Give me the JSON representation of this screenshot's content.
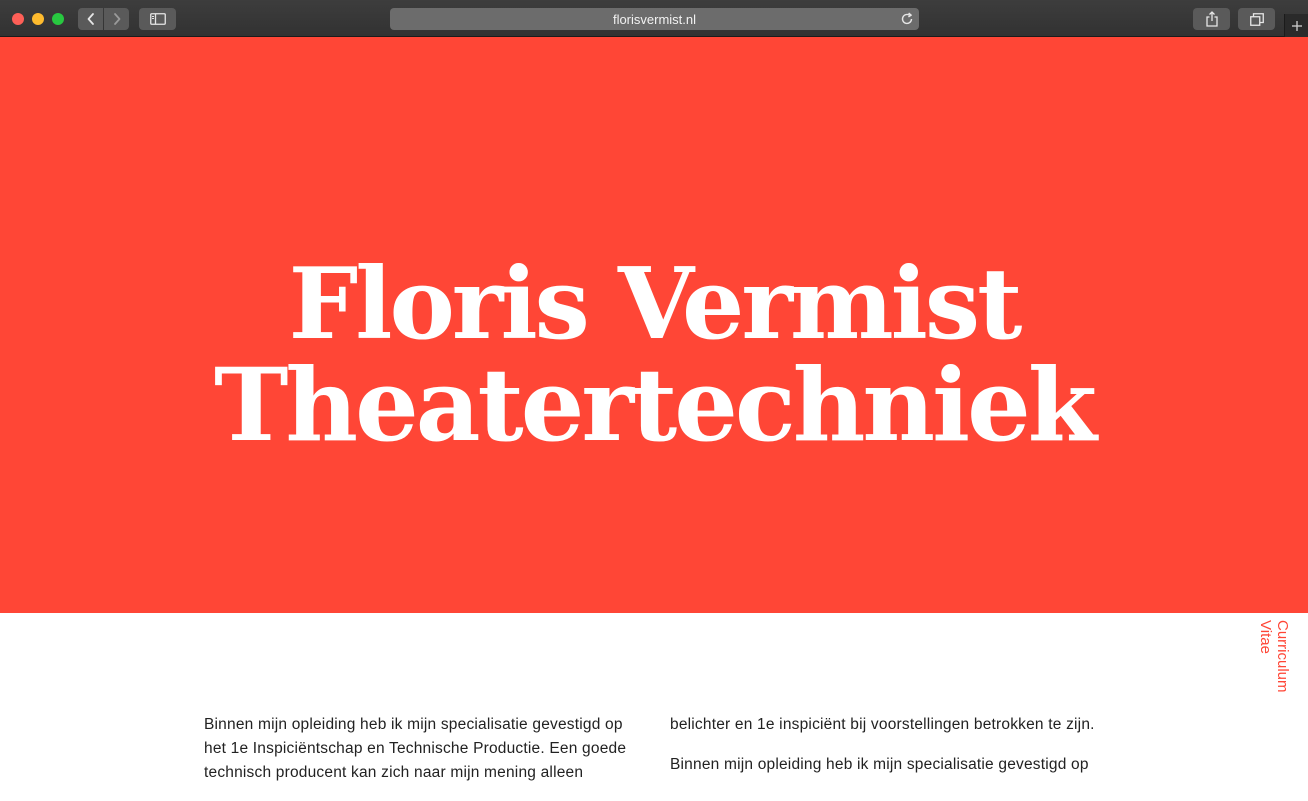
{
  "browser": {
    "url": "florisvermist.nl",
    "icons": [
      "chevron-left-icon",
      "chevron-right-icon",
      "sidebar-icon",
      "reload-icon",
      "share-icon",
      "tabs-icon",
      "plus-icon"
    ]
  },
  "hero": {
    "title_line1": "Floris Vermist",
    "title_line2": "Theatertechniek",
    "background_color": "#ff4636",
    "text_color": "#ffffff"
  },
  "side_tab": {
    "label": "Curriculum Vitae",
    "color": "#ff4636"
  },
  "content": {
    "left_paragraph": "Binnen mijn opleiding heb ik mijn specialisatie gevestigd op het 1e Inspiciëntschap en Technische Productie. Een goede technisch producent kan zich naar mijn mening alleen",
    "right_paragraph_1": "belichter en 1e inspiciënt bij voorstellingen betrokken te zijn.",
    "right_paragraph_2": "Binnen mijn opleiding heb ik mijn specialisatie gevestigd op"
  }
}
